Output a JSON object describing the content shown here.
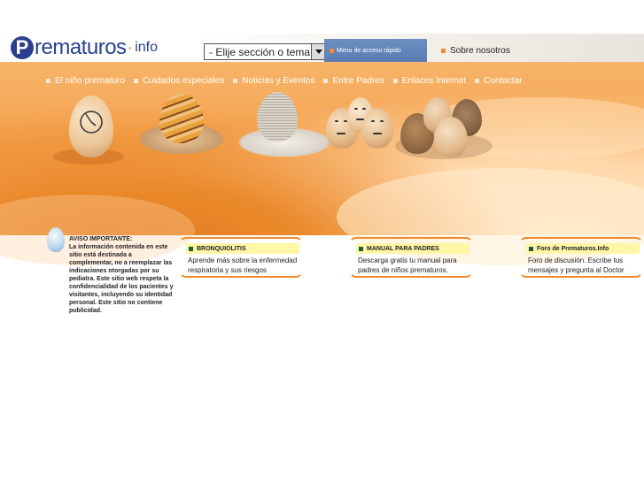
{
  "logo": {
    "letter": "P",
    "word": "rematuros",
    "dot": "·",
    "suffix": "info"
  },
  "nav_select": {
    "value": "- Elije sección o tema -"
  },
  "quick_menu": {
    "label": "Menu de acceso rápido"
  },
  "about_link": {
    "label": "Sobre nosotros"
  },
  "main_nav": [
    {
      "label": "El niño prematuro"
    },
    {
      "label": "Cuidados especiales"
    },
    {
      "label": "Noticias y Eventos"
    },
    {
      "label": "Entre Padres"
    },
    {
      "label": "Enlaces Internet"
    },
    {
      "label": "Contactar"
    }
  ],
  "notice": {
    "title": "AVISO IMPORTANTE:",
    "body": "La información contenida en este sitio está destinada a complementar, no a reemplazar las indicaciones otorgadas por su pediatra. Este sitio web respeta la confidencialidad de los pacientes y visitantes, incluyendo su identidad personal. Este sitio no contiene publicidad."
  },
  "boxes": [
    {
      "title": "BRONQUIOLITIS",
      "text": "Aprende más sobre la enfermedad respiratoria y sus riesgos"
    },
    {
      "title": "MANUAL PARA PADRES",
      "text": "Descarga gratis tu manual para padres de niños prematuros."
    },
    {
      "title": "Foro de Prematuros.Info",
      "text": "Foro de discusión. Escribe tus mensajes y pregunta al Doctor"
    }
  ],
  "colors": {
    "accent": "#f28a2c",
    "brand": "#2a3f8f",
    "box_header_bg": "#fff7a6"
  }
}
